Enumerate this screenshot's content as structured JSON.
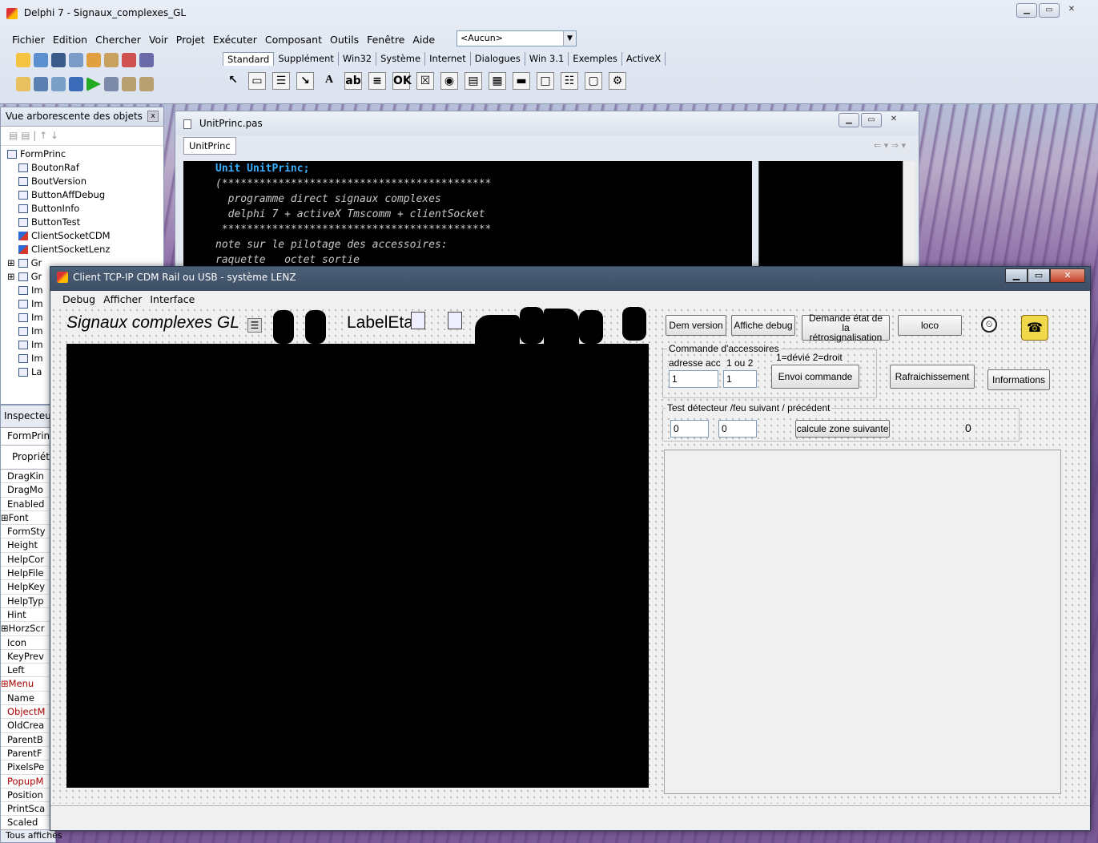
{
  "ide": {
    "title": "Delphi 7 - Signaux_complexes_GL",
    "menu": [
      "Fichier",
      "Edition",
      "Chercher",
      "Voir",
      "Projet",
      "Exécuter",
      "Composant",
      "Outils",
      "Fenêtre",
      "Aide"
    ],
    "combo_value": "<Aucun>",
    "palette_tabs": [
      "Standard",
      "Supplément",
      "Win32",
      "Système",
      "Internet",
      "Dialogues",
      "Win 3.1",
      "Exemples",
      "ActiveX"
    ]
  },
  "tree": {
    "title": "Vue arborescente des objets",
    "items": [
      "FormPrinc",
      "BoutonRaf",
      "BoutVersion",
      "ButtonAffDebug",
      "ButtonInfo",
      "ButtonTest",
      "ClientSocketCDM",
      "ClientSocketLenz",
      "Gr",
      "Gr",
      "Im",
      "Im",
      "Im",
      "Im",
      "Im",
      "Im",
      "La"
    ]
  },
  "inspector": {
    "title": "Inspecteu",
    "object": "FormPrinc",
    "tab": "Propriété",
    "props": [
      "DragKin",
      "DragMo",
      "Enabled",
      "⊞Font",
      "FormSty",
      "Height",
      "HelpCor",
      "HelpFile",
      "HelpKey",
      "HelpTyp",
      "Hint",
      "⊞HorzScr",
      "Icon",
      "KeyPrev",
      "Left",
      "⊞Menu",
      "Name",
      "ObjectM",
      "OldCrea",
      "ParentB",
      "ParentF",
      "PixelsPe",
      "PopupM",
      "Position",
      "PrintSca",
      "Scaled"
    ],
    "footer": "Tous affichés"
  },
  "editor": {
    "tab_file": "UnitPrinc.pas",
    "tab_unit": "UnitPrinc",
    "code": [
      "Unit UnitPrinc;",
      "(*******************************************",
      "  programme direct signaux complexes",
      "  delphi 7 + activeX Tmscomm + clientSocket",
      " *******************************************",
      "note sur le pilotage des accessoires:",
      "raquette   octet sortie"
    ]
  },
  "app": {
    "title": "Client TCP-IP CDM Rail ou USB - système LENZ",
    "menu": [
      "Debug",
      "Afficher",
      "Interface"
    ],
    "heading": "Signaux complexes GL",
    "label_etat": "LabelEtat",
    "buttons": {
      "dem_version": "Dem version",
      "affiche_debug": "Affiche debug",
      "demande_etat": "Demande état de la rétrosignalisation",
      "loco": "loco",
      "envoi": "Envoi commande",
      "rafraichissement": "Rafraichissement",
      "informations": "Informations",
      "calcule": "calcule zone suivante"
    },
    "commande": {
      "group_label": "Commande d'accessoires",
      "adresse_label": "adresse acc",
      "un_ou_deux": "1 ou 2",
      "devie_droit": "1=dévié   2=droit",
      "adresse_value": "1",
      "sortie_value": "1"
    },
    "test": {
      "group_label": "Test détecteur /feu suivant / précédent",
      "field1": "0",
      "field2": "0",
      "result": "0"
    }
  }
}
